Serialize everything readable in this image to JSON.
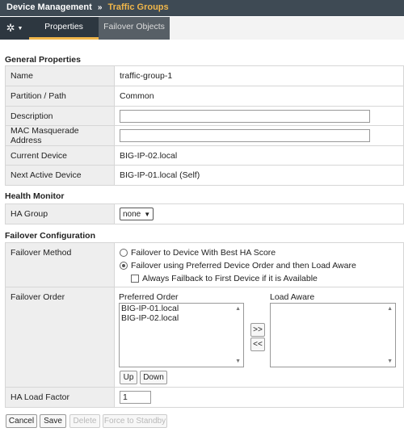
{
  "breadcrumb": {
    "root": "Device Management",
    "separator": "»",
    "current": "Traffic Groups"
  },
  "tabs": [
    {
      "label": "Properties"
    },
    {
      "label": "Failover Objects"
    }
  ],
  "general": {
    "title": "General Properties",
    "rows": [
      {
        "label": "Name",
        "value": "traffic-group-1"
      },
      {
        "label": "Partition / Path",
        "value": "Common"
      },
      {
        "label": "Description",
        "value": ""
      },
      {
        "label": "MAC Masquerade Address",
        "value": ""
      },
      {
        "label": "Current Device",
        "value": "BIG-IP-02.local"
      },
      {
        "label": "Next Active Device",
        "value": "BIG-IP-01.local (Self)"
      }
    ]
  },
  "health": {
    "title": "Health Monitor",
    "ha_group_label": "HA Group",
    "ha_group_value": "none"
  },
  "failover": {
    "title": "Failover Configuration",
    "method_label": "Failover Method",
    "option1": "Failover to Device With Best HA Score",
    "option2": "Failover using Preferred Device Order and then Load Aware",
    "failback": "Always Failback to First Device if it is Available",
    "order_label": "Failover Order",
    "preferred_title": "Preferred Order",
    "preferred_items": [
      "BIG-IP-01.local",
      "BIG-IP-02.local"
    ],
    "load_aware_title": "Load Aware",
    "move_right": ">>",
    "move_left": "<<",
    "up": "Up",
    "down": "Down",
    "load_factor_label": "HA Load Factor",
    "load_factor_value": "1"
  },
  "actions": {
    "cancel": "Cancel",
    "save": "Save",
    "delete": "Delete",
    "standby": "Force to Standby"
  },
  "colors": {
    "header_bg": "#3e4a54",
    "accent": "#f0b64a",
    "label_bg": "#eeeeee"
  }
}
